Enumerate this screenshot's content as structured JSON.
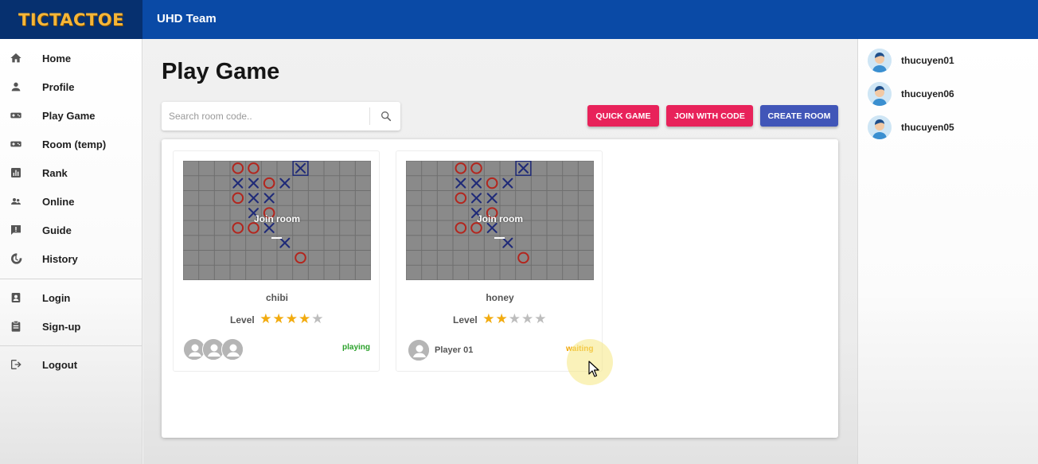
{
  "app": {
    "logo": "TICTACTOE",
    "team": "UHD Team"
  },
  "sidebar": {
    "items": [
      {
        "label": "Home",
        "icon": "home-icon"
      },
      {
        "label": "Profile",
        "icon": "person-icon"
      },
      {
        "label": "Play Game",
        "icon": "gamepad-icon"
      },
      {
        "label": "Room (temp)",
        "icon": "gamepad-icon"
      },
      {
        "label": "Rank",
        "icon": "bar-chart-icon"
      },
      {
        "label": "Online",
        "icon": "people-icon"
      },
      {
        "label": "Guide",
        "icon": "feedback-icon"
      },
      {
        "label": "History",
        "icon": "history-icon"
      }
    ],
    "auth_items": [
      {
        "label": "Login",
        "icon": "badge-icon"
      },
      {
        "label": "Sign-up",
        "icon": "clipboard-icon"
      }
    ],
    "logout": {
      "label": "Logout",
      "icon": "logout-icon"
    }
  },
  "main": {
    "title": "Play Game",
    "search": {
      "placeholder": "Search room code..",
      "value": ""
    },
    "buttons": {
      "quick_game": "QUICK GAME",
      "join_with_code": "JOIN WITH CODE",
      "create_room": "CREATE ROOM"
    },
    "colors": {
      "pink": "#e8225a",
      "indigo": "#4156b8",
      "playing": "#2aa12a",
      "waiting": "#f0a500",
      "o_mark": "#b3261e",
      "x_mark": "#1f2a78"
    },
    "rooms": [
      {
        "name": "chibi",
        "level_label": "Level",
        "stars": 4,
        "status": "playing",
        "overlay": "Join room",
        "players": [],
        "board": {
          "cols": 12,
          "rows": 8,
          "marks": [
            {
              "r": 0,
              "c": 3,
              "m": "O"
            },
            {
              "r": 0,
              "c": 4,
              "m": "O"
            },
            {
              "r": 0,
              "c": 7,
              "m": "X",
              "boxed": true
            },
            {
              "r": 1,
              "c": 3,
              "m": "X"
            },
            {
              "r": 1,
              "c": 4,
              "m": "X"
            },
            {
              "r": 1,
              "c": 5,
              "m": "O"
            },
            {
              "r": 1,
              "c": 6,
              "m": "X"
            },
            {
              "r": 2,
              "c": 3,
              "m": "O"
            },
            {
              "r": 2,
              "c": 4,
              "m": "X"
            },
            {
              "r": 2,
              "c": 5,
              "m": "X"
            },
            {
              "r": 3,
              "c": 4,
              "m": "X"
            },
            {
              "r": 3,
              "c": 5,
              "m": "O"
            },
            {
              "r": 4,
              "c": 3,
              "m": "O"
            },
            {
              "r": 4,
              "c": 4,
              "m": "O"
            },
            {
              "r": 4,
              "c": 5,
              "m": "X"
            },
            {
              "r": 5,
              "c": 6,
              "m": "X"
            },
            {
              "r": 6,
              "c": 7,
              "m": "O"
            }
          ]
        }
      },
      {
        "name": "honey",
        "level_label": "Level",
        "stars": 2,
        "status": "waiting",
        "overlay": "Join room",
        "players": [
          "Player 01"
        ],
        "board": {
          "cols": 12,
          "rows": 8,
          "marks": [
            {
              "r": 0,
              "c": 3,
              "m": "O"
            },
            {
              "r": 0,
              "c": 4,
              "m": "O"
            },
            {
              "r": 0,
              "c": 7,
              "m": "X",
              "boxed": true
            },
            {
              "r": 1,
              "c": 3,
              "m": "X"
            },
            {
              "r": 1,
              "c": 4,
              "m": "X"
            },
            {
              "r": 1,
              "c": 5,
              "m": "O"
            },
            {
              "r": 1,
              "c": 6,
              "m": "X"
            },
            {
              "r": 2,
              "c": 3,
              "m": "O"
            },
            {
              "r": 2,
              "c": 4,
              "m": "X"
            },
            {
              "r": 2,
              "c": 5,
              "m": "X"
            },
            {
              "r": 3,
              "c": 4,
              "m": "X"
            },
            {
              "r": 3,
              "c": 5,
              "m": "O"
            },
            {
              "r": 4,
              "c": 3,
              "m": "O"
            },
            {
              "r": 4,
              "c": 4,
              "m": "O"
            },
            {
              "r": 4,
              "c": 5,
              "m": "X"
            },
            {
              "r": 5,
              "c": 6,
              "m": "X"
            },
            {
              "r": 6,
              "c": 7,
              "m": "O"
            }
          ]
        }
      }
    ]
  },
  "online_users": [
    "thucuyen01",
    "thucuyen06",
    "thucuyen05"
  ]
}
